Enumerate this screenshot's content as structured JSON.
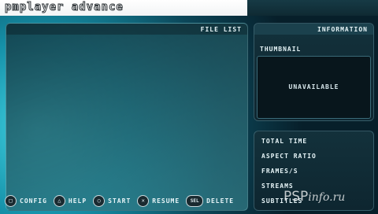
{
  "app": {
    "logo_text": "pmplayer advance"
  },
  "file_panel": {
    "title": "FILE LIST"
  },
  "info_panel": {
    "title": "INFORMATION",
    "thumbnail_label": "THUMBNAIL",
    "thumbnail_status": "UNAVAILABLE"
  },
  "meta": {
    "items": [
      "TOTAL TIME",
      "ASPECT RATIO",
      "FRAMES/S",
      "STREAMS",
      "SUBTITLES"
    ]
  },
  "footer": {
    "buttons": [
      {
        "icon": "square-button-icon",
        "glyph": "□",
        "label": "CONFIG"
      },
      {
        "icon": "triangle-button-icon",
        "glyph": "△",
        "label": "HELP"
      },
      {
        "icon": "circle-button-icon",
        "glyph": "○",
        "label": "START"
      },
      {
        "icon": "cross-button-icon",
        "glyph": "✕",
        "label": "RESUME"
      },
      {
        "icon": "select-button-icon",
        "glyph": "SEL",
        "label": "DELETE"
      }
    ]
  },
  "watermark": {
    "brand": "PSP",
    "domain": "info.ru"
  }
}
